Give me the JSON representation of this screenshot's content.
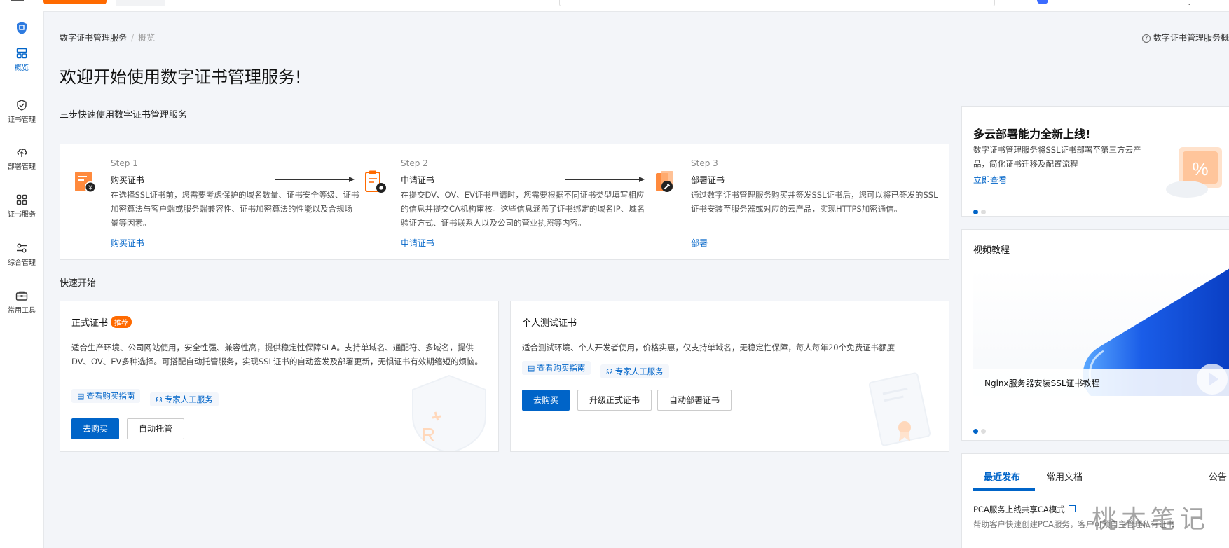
{
  "breadcrumb": {
    "root": "数字证书管理服务",
    "current": "概览"
  },
  "help_link": "数字证书管理服务概",
  "page_title": "欢迎开始使用数字证书管理服务!",
  "sidebar": {
    "items": [
      {
        "label": "概览",
        "icon": "overview-icon",
        "active": true
      },
      {
        "label": "证书管理",
        "icon": "shield-check-icon"
      },
      {
        "label": "部署管理",
        "icon": "cloud-upload-icon"
      },
      {
        "label": "证书服务",
        "icon": "grid-icon"
      },
      {
        "label": "综合管理",
        "icon": "sliders-icon"
      },
      {
        "label": "常用工具",
        "icon": "toolbox-icon"
      }
    ]
  },
  "steps_section": {
    "title": "三步快速使用数字证书管理服务",
    "steps": [
      {
        "num": "Step 1",
        "title": "购买证书",
        "desc": "在选择SSL证书前，您需要考虑保护的域名数量、证书安全等级、证书加密算法与客户端或服务端兼容性、证书加密算法的性能以及合规场景等因素。",
        "link": "购买证书"
      },
      {
        "num": "Step 2",
        "title": "申请证书",
        "desc": "在提交DV、OV、EV证书申请时，您需要根据不同证书类型填写相应的信息并提交CA机构审核。这些信息涵盖了证书绑定的域名IP、域名验证方式、证书联系人以及公司的营业执照等内容。",
        "link": "申请证书"
      },
      {
        "num": "Step 3",
        "title": "部署证书",
        "desc": "通过数字证书管理服务购买并签发SSL证书后，您可以将已签发的SSL证书安装至服务器或对应的云产品，实现HTTPS加密通信。",
        "link": "部署"
      }
    ]
  },
  "quick_start": {
    "title": "快速开始",
    "formal": {
      "title": "正式证书",
      "badge": "推荐",
      "desc": "适合生产环境、公司网站使用，安全性强、兼容性高，提供稳定性保障SLA。支持单域名、通配符、多域名，提供DV、OV、EV多种选择。可搭配自动托管服务，实现SSL证书的自动签发及部署更新，无惧证书有效期缩短的烦恼。",
      "guide": "查看购买指南",
      "expert": "专家人工服务",
      "buy": "去购买",
      "auto": "自动托管"
    },
    "test": {
      "title": "个人测试证书",
      "desc": "适合测试环境、个人开发者使用，价格实惠，仅支持单域名，无稳定性保障，每人每年20个免费证书额度",
      "guide": "查看购买指南",
      "expert": "专家人工服务",
      "buy": "去购买",
      "upgrade": "升级正式证书",
      "deploy": "自动部署证书"
    }
  },
  "promo": {
    "title": "多云部署能力全新上线!",
    "desc": "数字证书管理服务将SSL证书部署至第三方云产品，简化证书迁移及配置流程",
    "link": "立即查看"
  },
  "video": {
    "title": "视频教程",
    "caption": "Nginx服务器安装SSL证书教程"
  },
  "news": {
    "tabs": [
      "最近发布",
      "常用文档",
      "公告"
    ],
    "items": [
      {
        "title": "PCA服务上线共享CA模式",
        "sub": "帮助客户快速创建PCA服务，客户可预自主管理私有证书"
      }
    ]
  },
  "watermark": "桃木笔记",
  "colors": {
    "primary": "#0064c8",
    "accent": "#ff6a00",
    "background": "#f3f5f9"
  }
}
